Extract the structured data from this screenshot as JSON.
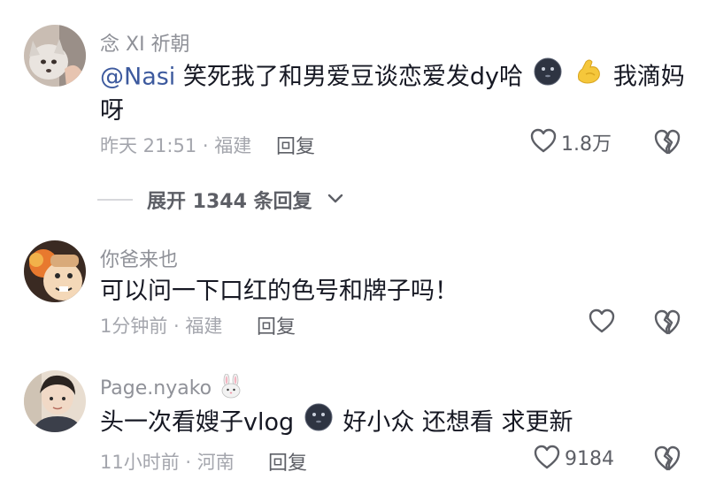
{
  "comments": [
    {
      "username": "念 XI 祈朝",
      "mention": "@Nasi",
      "text_part1": "笑死我了和男爱豆谈恋爱发dy哈",
      "text_part2": "我滴妈",
      "text_line2": "呀",
      "meta": "昨天 21:51 · 福建",
      "reply": "回复",
      "likes": "1.8万"
    },
    {
      "username": "你爸来也",
      "text_line1": "可以问一下口红的色号和牌子吗！",
      "meta": "1分钟前 · 福建",
      "reply": "回复",
      "likes": ""
    },
    {
      "username": "Page.nyako",
      "text_part1": "头一次看嫂子vlog",
      "text_part2": "好小众 还想看 求更新",
      "meta": "11小时前 · 河南",
      "reply": "回复",
      "likes": "9184"
    }
  ],
  "expand_replies": "展开 1344 条回复"
}
